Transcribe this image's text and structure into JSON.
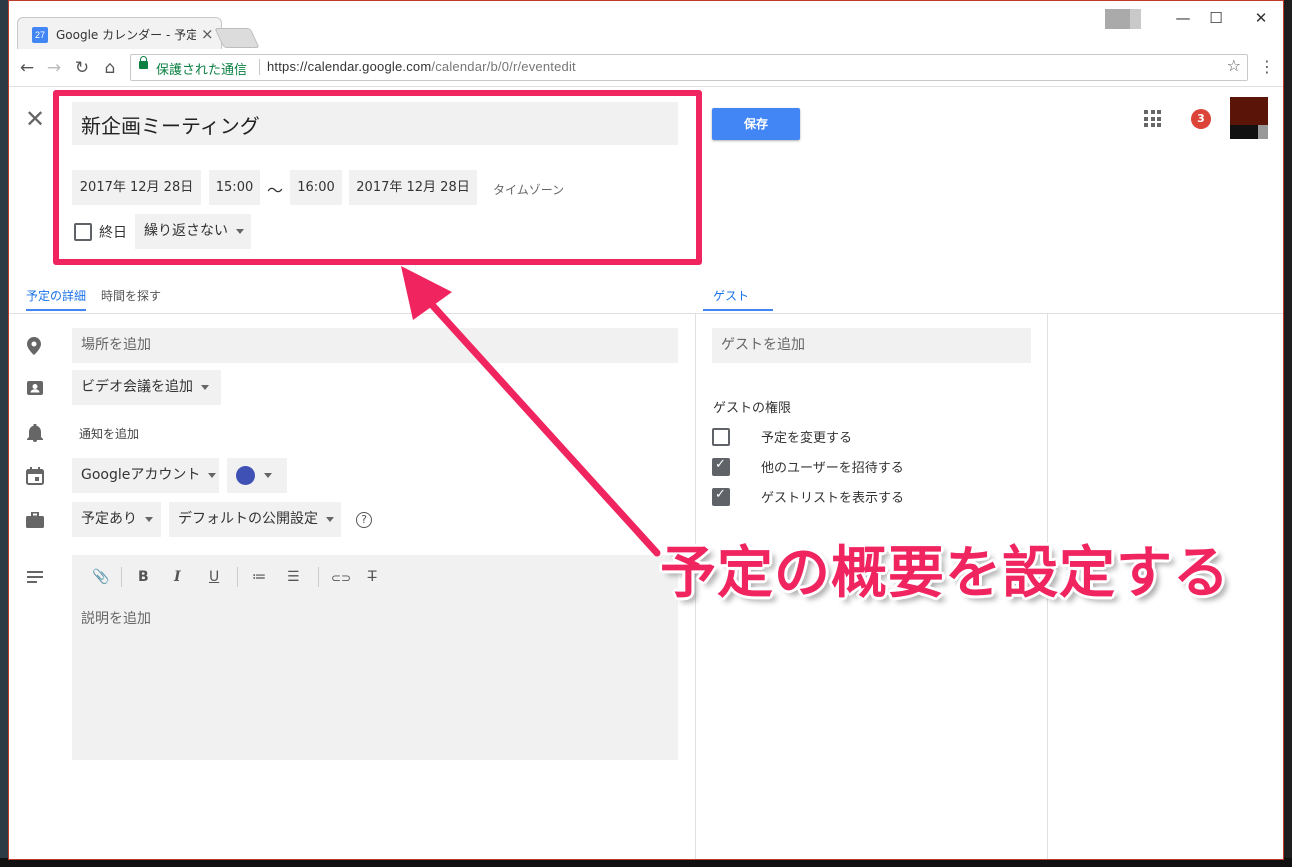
{
  "browser": {
    "tab_favicon_text": "27",
    "tab_title": "Google カレンダー - 予定の",
    "tab_close": "×",
    "window_controls": {
      "minimize": "—",
      "maximize": "☐",
      "close": "✕"
    },
    "nav": {
      "back": "←",
      "forward": "→",
      "reload": "↻",
      "home": "⌂"
    },
    "secure_label": "保護された通信",
    "url_host": "https://calendar.google.com",
    "url_path": "/calendar/b/0/r/eventedit",
    "star": "☆",
    "menu": "⋮"
  },
  "event": {
    "close": "✕",
    "title": "新企画ミーティング",
    "start_date": "2017年 12月 28日",
    "start_time": "15:00",
    "separator": "〜",
    "end_time": "16:00",
    "end_date": "2017年 12月 28日",
    "timezone_label": "タイムゾーン",
    "all_day_label": "終日",
    "all_day_checked": false,
    "repeat_value": "繰り返さない",
    "save_label": "保存"
  },
  "header": {
    "apps_icon": "apps-grid-icon",
    "notification_count": "3"
  },
  "tabs": {
    "details": "予定の詳細",
    "find_time": "時間を探す",
    "guests": "ゲスト"
  },
  "details": {
    "location_placeholder": "場所を追加",
    "video_conf": "ビデオ会議を追加",
    "notification": "通知を追加",
    "calendar_account": "Googleアカウント",
    "event_color": "#3f51b5",
    "availability": "予定あり",
    "visibility": "デフォルトの公開設定",
    "help": "?",
    "description_placeholder": "説明を追加",
    "toolbar": {
      "attach": "📎",
      "bold": "B",
      "italic": "I",
      "underline": "U",
      "numbered_list": "≔",
      "bulleted_list": "☰",
      "link": "⊂⊃",
      "clear_format": "T̶"
    }
  },
  "guests": {
    "add_placeholder": "ゲストを追加",
    "permissions_title": "ゲストの権限",
    "permissions": [
      {
        "label": "予定を変更する",
        "checked": false
      },
      {
        "label": "他のユーザーを招待する",
        "checked": true
      },
      {
        "label": "ゲストリストを表示する",
        "checked": true
      }
    ]
  },
  "annotation": {
    "caption": "予定の概要を設定する",
    "color": "#f0245f"
  }
}
